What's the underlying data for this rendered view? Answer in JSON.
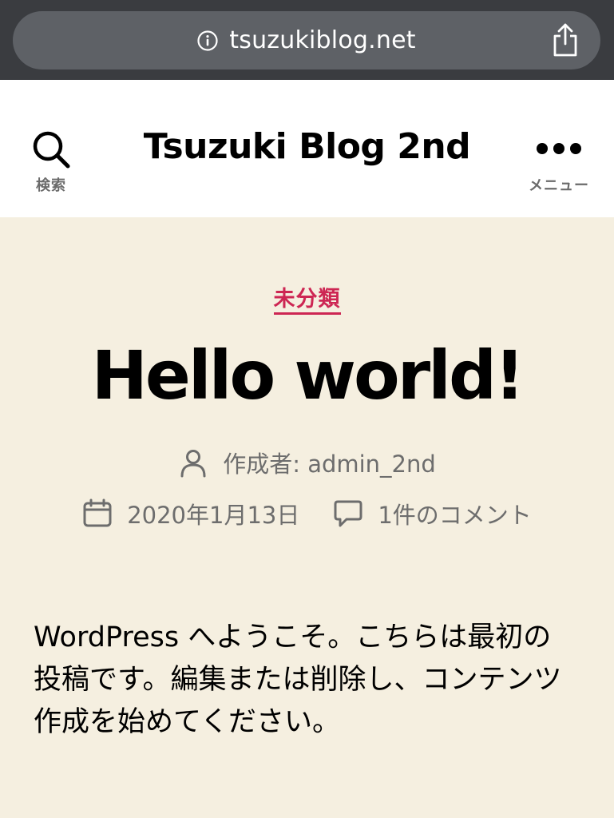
{
  "browser": {
    "url": "tsuzukiblog.net",
    "icons": {
      "info": "info-circle-icon",
      "share": "share-icon"
    }
  },
  "header": {
    "site_title": "Tsuzuki Blog 2nd",
    "search_label": "検索",
    "menu_label": "メニュー",
    "icons": {
      "search": "search-icon",
      "menu": "ellipsis-icon"
    }
  },
  "post": {
    "category": "未分類",
    "title": "Hello world!",
    "author_line": "作成者: admin_2nd",
    "date": "2020年1月13日",
    "comments": "1件のコメント",
    "content": "WordPress へようこそ。こちらは最初の投稿です。編集または削除し、コンテンツ作成を始めてください。",
    "icons": {
      "author": "user-icon",
      "date": "calendar-icon",
      "comments": "comment-icon"
    }
  },
  "colors": {
    "accent": "#cd2653",
    "background": "#f5efe0",
    "browser_bar": "#3a3c40",
    "url_pill": "#5e6166",
    "meta_text": "#6d6d6d"
  }
}
